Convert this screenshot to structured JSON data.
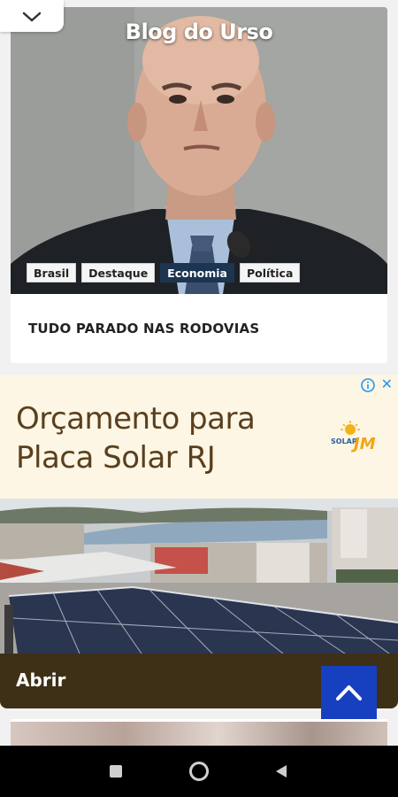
{
  "header": {
    "site_title": "Blog do Urso"
  },
  "article": {
    "tags": [
      {
        "label": "Brasil",
        "active": false
      },
      {
        "label": "Destaque",
        "active": false
      },
      {
        "label": "Economia",
        "active": true
      },
      {
        "label": "Política",
        "active": false
      }
    ],
    "headline": "TUDO PARADO NAS RODOVIAS"
  },
  "ad": {
    "headline_line1": "Orçamento para",
    "headline_line2": "Placa Solar RJ",
    "logo_small": "SOLAR",
    "logo_big": "JM",
    "cta_label": "Abrir",
    "close_glyph": "✕"
  },
  "colors": {
    "tag_active": "#1c3550",
    "ad_text": "#5a3f1e",
    "ad_background": "#fdf6e4",
    "scroll_button": "#1740c0"
  },
  "icons": {
    "collapse": "chevron-down-icon",
    "ad_info": "info-icon",
    "ad_close": "close-icon",
    "scroll_top": "chevron-up-icon",
    "nav_recents": "square-icon",
    "nav_home": "circle-icon",
    "nav_back": "triangle-back-icon"
  }
}
